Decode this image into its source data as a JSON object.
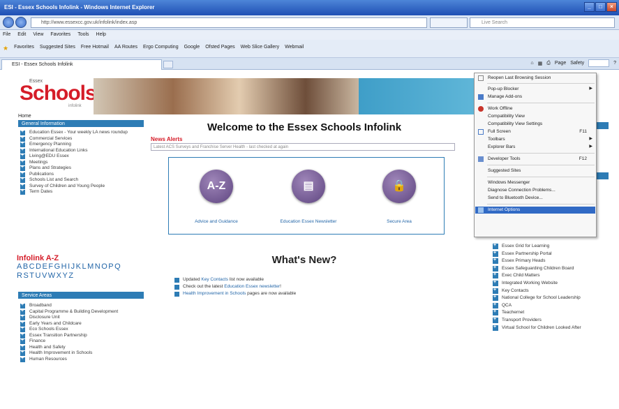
{
  "window": {
    "title": "ESI - Essex Schools Infolink - Windows Internet Explorer"
  },
  "address": {
    "url": "http://www.essexcc.gov.uk/infolink/index.asp",
    "search_placeholder": "Live Search"
  },
  "menubar": [
    "File",
    "Edit",
    "View",
    "Favorites",
    "Tools",
    "Help"
  ],
  "favorites": [
    "Favorites",
    "Suggested Sites",
    "Free Hotmail",
    "AA Routes",
    "Ergo Computing",
    "Google",
    "Ofsted Pages",
    "Web Slice Gallery",
    "Webmail"
  ],
  "tab": {
    "title": "ESI - Essex Schools Infolink"
  },
  "cmdbar": {
    "page": "Page",
    "safety": "Safety"
  },
  "logo": {
    "essex": "Essex",
    "schools": "Schools",
    "infolink": "infolink"
  },
  "home": "Home",
  "general_info": {
    "heading": "General Information",
    "items": [
      "Education Essex - Your weekly LA news roundup",
      "Commercial Services",
      "Emergency Planning",
      "International Education Links",
      "Living@EDU Essex",
      "Meetings",
      "Plans and Strategies",
      "Publications",
      "Schools List and Search",
      "Survey of Children and Young People",
      "Term Dates"
    ]
  },
  "infolink_az": {
    "title": "Infolink A-Z",
    "row1": "ABCDEFGHIJKLMNOPQ",
    "row2": "RSTUVWXYZ"
  },
  "service_areas": {
    "heading": "Service Areas",
    "items": [
      "Broadband",
      "Capital Programme & Building Development",
      "Disclosure Unit",
      "Early Years and Childcare",
      "Eco Schools Essex",
      "Essex Transition Partnership",
      "Finance",
      "Health and Safety",
      "Health Improvement in Schools",
      "Human Resources"
    ]
  },
  "main": {
    "welcome": "Welcome to the Essex Schools Infolink",
    "news_alerts": "News Alerts",
    "news_text": "Latest ACS Surveys and Franchise Server Health - last checked at again",
    "icons": [
      {
        "glyph": "A-Z",
        "label": "Advice and Guidance"
      },
      {
        "glyph": "▤",
        "label": "Education Essex Newsletter"
      },
      {
        "glyph": "🔒",
        "label": "Secure Area"
      }
    ],
    "whats_new": "What's New?",
    "news": [
      {
        "pre": "Updated ",
        "link": "Key Contacts",
        "post": " list now available"
      },
      {
        "pre": "Check out the latest ",
        "link": "Education Essex newsletter",
        "post": "!"
      },
      {
        "pre": "",
        "link": "Health Improvement in Schools",
        "post": " pages are now available"
      }
    ]
  },
  "right_links": [
    "Essex Grid for Learning",
    "Essex Partnership Portal",
    "Essex Primary Heads",
    "Essex Safeguarding Children Board",
    "Exec Child Matters",
    "Integrated Working Website",
    "Key Contacts",
    "National College for School Leadership",
    "QCA",
    "Teachernet",
    "Transport Providers",
    "Virtual School for Children Looked After"
  ],
  "tools_menu": {
    "items": [
      "Reopen Last Browsing Session",
      "Pop-up Blocker",
      "Manage Add-ons",
      "Work Offline",
      "Compatibility View",
      "Compatibility View Settings",
      "Full Screen",
      "Toolbars",
      "Explorer Bars",
      "Developer Tools",
      "Suggested Sites",
      "Windows Messenger",
      "Diagnose Connection Problems...",
      "Send to Bluetooth Device...",
      "Internet Options"
    ],
    "shortcuts": {
      "full_screen": "F11",
      "developer_tools": "F12"
    },
    "selected": "Internet Options"
  },
  "colors": {
    "accent_blue": "#2d7cb5",
    "red": "#d51c28",
    "purple": "#6e5491",
    "selection": "#316ac5"
  }
}
